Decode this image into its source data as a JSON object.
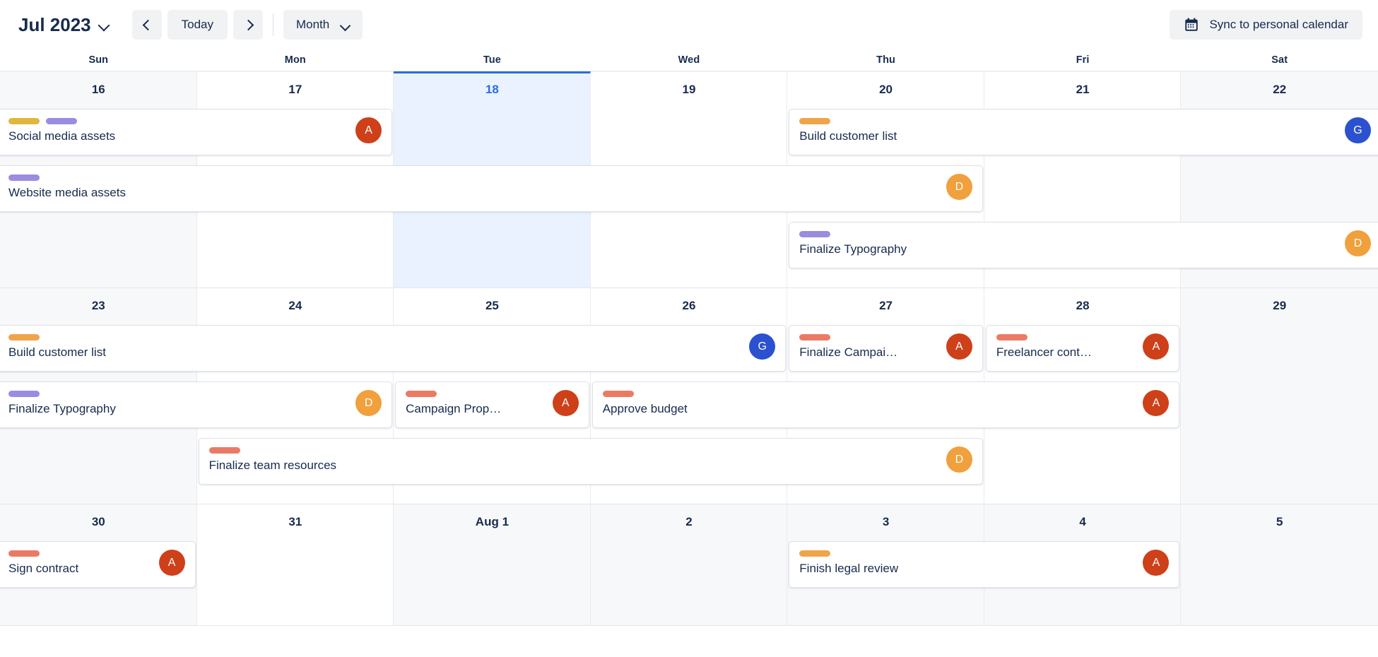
{
  "toolbar": {
    "month_label": "Jul 2023",
    "prev_label": "",
    "today_label": "Today",
    "next_label": "",
    "view_label": "Month",
    "sync_label": "Sync to personal calendar"
  },
  "weekdays": [
    "Sun",
    "Mon",
    "Tue",
    "Wed",
    "Thu",
    "Fri",
    "Sat"
  ],
  "colors": {
    "accent_blue": "#2B6CE0",
    "today_bg": "#E9F2FE",
    "weekend_bg": "#F7F8F9",
    "tag_gold": "#E0B63C",
    "tag_purple": "#9B8CE0",
    "tag_orange": "#F0A44A",
    "tag_salmon": "#EB7A65",
    "avatar_a": "#CE4019",
    "avatar_d": "#F0A03C",
    "avatar_g": "#2B51D0",
    "text": "#172B4D"
  },
  "weeks": [
    {
      "dates": [
        {
          "label": "16",
          "weekend": true,
          "othermonth": false,
          "today": false
        },
        {
          "label": "17",
          "weekend": false,
          "othermonth": false,
          "today": false
        },
        {
          "label": "18",
          "weekend": false,
          "othermonth": false,
          "today": true
        },
        {
          "label": "19",
          "weekend": false,
          "othermonth": false,
          "today": false
        },
        {
          "label": "20",
          "weekend": false,
          "othermonth": false,
          "today": false
        },
        {
          "label": "21",
          "weekend": false,
          "othermonth": false,
          "today": false
        },
        {
          "label": "22",
          "weekend": true,
          "othermonth": false,
          "today": false
        }
      ],
      "rows": [
        [
          {
            "title": "Social media assets",
            "tags": [
              "tag_gold",
              "tag_purple"
            ],
            "avatar": "A",
            "avatar_color": "avatar_a",
            "start": 0,
            "span": 2,
            "bleed_left": true
          },
          {
            "title": "Build customer list",
            "tags": [
              "tag_orange"
            ],
            "avatar": "G",
            "avatar_color": "avatar_g",
            "start": 4,
            "span": 3,
            "bleed_right": true
          }
        ],
        [
          {
            "title": "Website media assets",
            "tags": [
              "tag_purple"
            ],
            "avatar": "D",
            "avatar_color": "avatar_d",
            "start": 0,
            "span": 5,
            "bleed_left": true
          }
        ],
        [
          {
            "title": "Finalize Typography",
            "tags": [
              "tag_purple"
            ],
            "avatar": "D",
            "avatar_color": "avatar_d",
            "start": 4,
            "span": 3,
            "bleed_right": true
          }
        ]
      ]
    },
    {
      "dates": [
        {
          "label": "23",
          "weekend": true,
          "othermonth": false,
          "today": false
        },
        {
          "label": "24",
          "weekend": false,
          "othermonth": false,
          "today": false
        },
        {
          "label": "25",
          "weekend": false,
          "othermonth": false,
          "today": false
        },
        {
          "label": "26",
          "weekend": false,
          "othermonth": false,
          "today": false
        },
        {
          "label": "27",
          "weekend": false,
          "othermonth": false,
          "today": false
        },
        {
          "label": "28",
          "weekend": false,
          "othermonth": false,
          "today": false
        },
        {
          "label": "29",
          "weekend": true,
          "othermonth": false,
          "today": false
        }
      ],
      "rows": [
        [
          {
            "title": "Build customer list",
            "tags": [
              "tag_orange"
            ],
            "avatar": "G",
            "avatar_color": "avatar_g",
            "start": 0,
            "span": 4,
            "bleed_left": true
          },
          {
            "title": "Finalize Campai…",
            "tags": [
              "tag_salmon"
            ],
            "avatar": "A",
            "avatar_color": "avatar_a",
            "start": 4,
            "span": 1
          },
          {
            "title": "Freelancer cont…",
            "tags": [
              "tag_salmon"
            ],
            "avatar": "A",
            "avatar_color": "avatar_a",
            "start": 5,
            "span": 1
          }
        ],
        [
          {
            "title": "Finalize Typography",
            "tags": [
              "tag_purple"
            ],
            "avatar": "D",
            "avatar_color": "avatar_d",
            "start": 0,
            "span": 2,
            "bleed_left": true
          },
          {
            "title": "Campaign Prop…",
            "tags": [
              "tag_salmon"
            ],
            "avatar": "A",
            "avatar_color": "avatar_a",
            "start": 2,
            "span": 1
          },
          {
            "title": "Approve budget",
            "tags": [
              "tag_salmon"
            ],
            "avatar": "A",
            "avatar_color": "avatar_a",
            "start": 3,
            "span": 3
          }
        ],
        [
          {
            "title": "Finalize team resources",
            "tags": [
              "tag_salmon"
            ],
            "avatar": "D",
            "avatar_color": "avatar_d",
            "start": 1,
            "span": 4
          }
        ]
      ]
    },
    {
      "dates": [
        {
          "label": "30",
          "weekend": true,
          "othermonth": false,
          "today": false
        },
        {
          "label": "31",
          "weekend": false,
          "othermonth": false,
          "today": false
        },
        {
          "label": "Aug 1",
          "weekend": false,
          "othermonth": true,
          "today": false
        },
        {
          "label": "2",
          "weekend": false,
          "othermonth": true,
          "today": false
        },
        {
          "label": "3",
          "weekend": false,
          "othermonth": true,
          "today": false
        },
        {
          "label": "4",
          "weekend": false,
          "othermonth": true,
          "today": false
        },
        {
          "label": "5",
          "weekend": true,
          "othermonth": true,
          "today": false
        }
      ],
      "rows": [
        [
          {
            "title": "Sign contract",
            "tags": [
              "tag_salmon"
            ],
            "avatar": "A",
            "avatar_color": "avatar_a",
            "start": 0,
            "span": 1,
            "bleed_left": true
          },
          {
            "title": "Finish legal review",
            "tags": [
              "tag_orange"
            ],
            "avatar": "A",
            "avatar_color": "avatar_a",
            "start": 4,
            "span": 2
          }
        ]
      ]
    }
  ]
}
